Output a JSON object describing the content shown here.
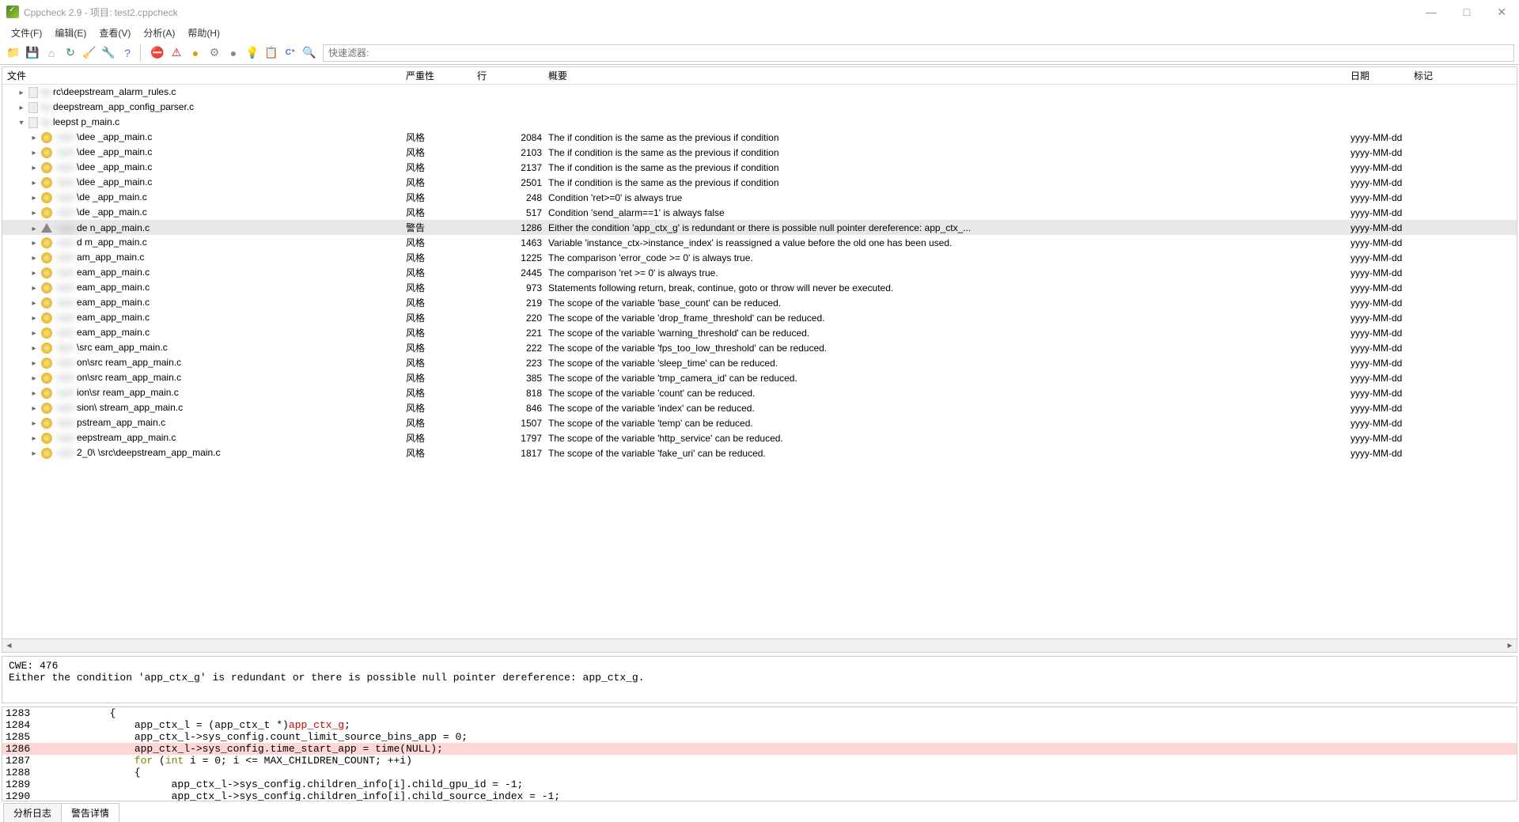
{
  "window": {
    "title": "Cppcheck 2.9 - 项目: test2.cppcheck"
  },
  "menu": {
    "file": "文件(F)",
    "edit": "编辑(E)",
    "view": "查看(V)",
    "analyze": "分析(A)",
    "help": "帮助(H)"
  },
  "filter_placeholder": "快速滤器:",
  "headers": {
    "file": "文件",
    "severity": "严重性",
    "line": "行",
    "summary": "概要",
    "date": "日期",
    "mark": "标记"
  },
  "tree_roots": [
    {
      "file": "rc\\deepstream_alarm_rules.c",
      "indent": 1
    },
    {
      "file": "deepstream_app_config_parser.c",
      "indent": 1
    },
    {
      "file": "leepst        p_main.c",
      "indent": 1,
      "expanded": true
    }
  ],
  "rows": [
    {
      "icon": "style",
      "file": "\\dee        _app_main.c",
      "sev": "风格",
      "line": "2084",
      "sum": "The if condition is the same as the previous if condition",
      "date": "yyyy-MM-dd"
    },
    {
      "icon": "style",
      "file": "\\dee        _app_main.c",
      "sev": "风格",
      "line": "2103",
      "sum": "The if condition is the same as the previous if condition",
      "date": "yyyy-MM-dd"
    },
    {
      "icon": "style",
      "file": "\\dee        _app_main.c",
      "sev": "风格",
      "line": "2137",
      "sum": "The if condition is the same as the previous if condition",
      "date": "yyyy-MM-dd"
    },
    {
      "icon": "style",
      "file": "\\dee        _app_main.c",
      "sev": "风格",
      "line": "2501",
      "sum": "The if condition is the same as the previous if condition",
      "date": "yyyy-MM-dd"
    },
    {
      "icon": "style",
      "file": "\\de         _app_main.c",
      "sev": "风格",
      "line": "248",
      "sum": "Condition 'ret>=0' is always true",
      "date": "yyyy-MM-dd"
    },
    {
      "icon": "style",
      "file": "\\de         _app_main.c",
      "sev": "风格",
      "line": "517",
      "sum": "Condition 'send_alarm==1' is always false",
      "date": "yyyy-MM-dd"
    },
    {
      "icon": "warn",
      "file": "de        n_app_main.c",
      "sev": "警告",
      "line": "1286",
      "sum": "Either the condition 'app_ctx_g' is redundant or there is possible null pointer dereference: app_ctx_...",
      "date": "yyyy-MM-dd",
      "selected": true
    },
    {
      "icon": "style",
      "file": "d         m_app_main.c",
      "sev": "风格",
      "line": "1463",
      "sum": "Variable 'instance_ctx->instance_index' is reassigned a value before the old one has been used.",
      "date": "yyyy-MM-dd"
    },
    {
      "icon": "style",
      "file": "         am_app_main.c",
      "sev": "风格",
      "line": "1225",
      "sum": "The comparison 'error_code >= 0' is always true.",
      "date": "yyyy-MM-dd"
    },
    {
      "icon": "style",
      "file": "        eam_app_main.c",
      "sev": "风格",
      "line": "2445",
      "sum": "The comparison 'ret >= 0' is always true.",
      "date": "yyyy-MM-dd"
    },
    {
      "icon": "style",
      "file": "        eam_app_main.c",
      "sev": "风格",
      "line": "973",
      "sum": "Statements following return, break, continue, goto or throw will never be executed.",
      "date": "yyyy-MM-dd"
    },
    {
      "icon": "style",
      "file": "        eam_app_main.c",
      "sev": "风格",
      "line": "219",
      "sum": "The scope of the variable 'base_count' can be reduced.",
      "date": "yyyy-MM-dd"
    },
    {
      "icon": "style",
      "file": "        eam_app_main.c",
      "sev": "风格",
      "line": "220",
      "sum": "The scope of the variable 'drop_frame_threshold' can be reduced.",
      "date": "yyyy-MM-dd"
    },
    {
      "icon": "style",
      "file": "        eam_app_main.c",
      "sev": "风格",
      "line": "221",
      "sum": "The scope of the variable 'warning_threshold' can be reduced.",
      "date": "yyyy-MM-dd"
    },
    {
      "icon": "style",
      "file": "\\src       eam_app_main.c",
      "sev": "风格",
      "line": "222",
      "sum": "The scope of the variable 'fps_too_low_threshold' can be reduced.",
      "date": "yyyy-MM-dd"
    },
    {
      "icon": "style",
      "file": "on\\src     ream_app_main.c",
      "sev": "风格",
      "line": "223",
      "sum": "The scope of the variable 'sleep_time' can be reduced.",
      "date": "yyyy-MM-dd"
    },
    {
      "icon": "style",
      "file": "on\\src     ream_app_main.c",
      "sev": "风格",
      "line": "385",
      "sum": "The scope of the variable 'tmp_camera_id' can be reduced.",
      "date": "yyyy-MM-dd"
    },
    {
      "icon": "style",
      "file": "ion\\sr     ream_app_main.c",
      "sev": "风格",
      "line": "818",
      "sum": "The scope of the variable 'count' can be reduced.",
      "date": "yyyy-MM-dd"
    },
    {
      "icon": "style",
      "file": "sion\\      stream_app_main.c",
      "sev": "风格",
      "line": "846",
      "sum": "The scope of the variable 'index' can be reduced.",
      "date": "yyyy-MM-dd"
    },
    {
      "icon": "style",
      "file": "         pstream_app_main.c",
      "sev": "风格",
      "line": "1507",
      "sum": "The scope of the variable 'temp' can be reduced.",
      "date": "yyyy-MM-dd"
    },
    {
      "icon": "style",
      "file": "        eepstream_app_main.c",
      "sev": "风格",
      "line": "1797",
      "sum": "The scope of the variable 'http_service' can be reduced.",
      "date": "yyyy-MM-dd"
    },
    {
      "icon": "style",
      "file": "2_0\\      \\src\\deepstream_app_main.c",
      "sev": "风格",
      "line": "1817",
      "sum": "The scope of the variable 'fake_uri' can be reduced.",
      "date": "yyyy-MM-dd"
    }
  ],
  "detail": {
    "cwe": "CWE: 476",
    "msg": "Either the condition 'app_ctx_g' is redundant or there is possible null pointer dereference: app_ctx_g."
  },
  "code": [
    {
      "n": "1283",
      "t": "            {"
    },
    {
      "n": "1284",
      "t": "                app_ctx_l = (app_ctx_t *)",
      "err": "app_ctx_g",
      ";": ";"
    },
    {
      "n": "1285",
      "t": "                app_ctx_l->sys_config.count_limit_source_bins_app = 0;"
    },
    {
      "n": "1286",
      "t": "                app_ctx_l->sys_config.time_start_app = time(NULL);",
      "hl": true
    },
    {
      "n": "1287",
      "pre": "                ",
      "kw": "for",
      "t2": " (",
      "kw2": "int",
      "t3": " i = 0; i <= MAX_CHILDREN_COUNT; ++i)"
    },
    {
      "n": "1288",
      "t": "                {"
    },
    {
      "n": "1289",
      "t": "                      app_ctx_l->sys_config.children_info[i].child_gpu_id = -1;"
    },
    {
      "n": "1290",
      "t": "                      app_ctx_l->sys_config.children_info[i].child_source_index = -1;"
    }
  ],
  "tabs": {
    "log": "分析日志",
    "detail": "警告详情"
  }
}
